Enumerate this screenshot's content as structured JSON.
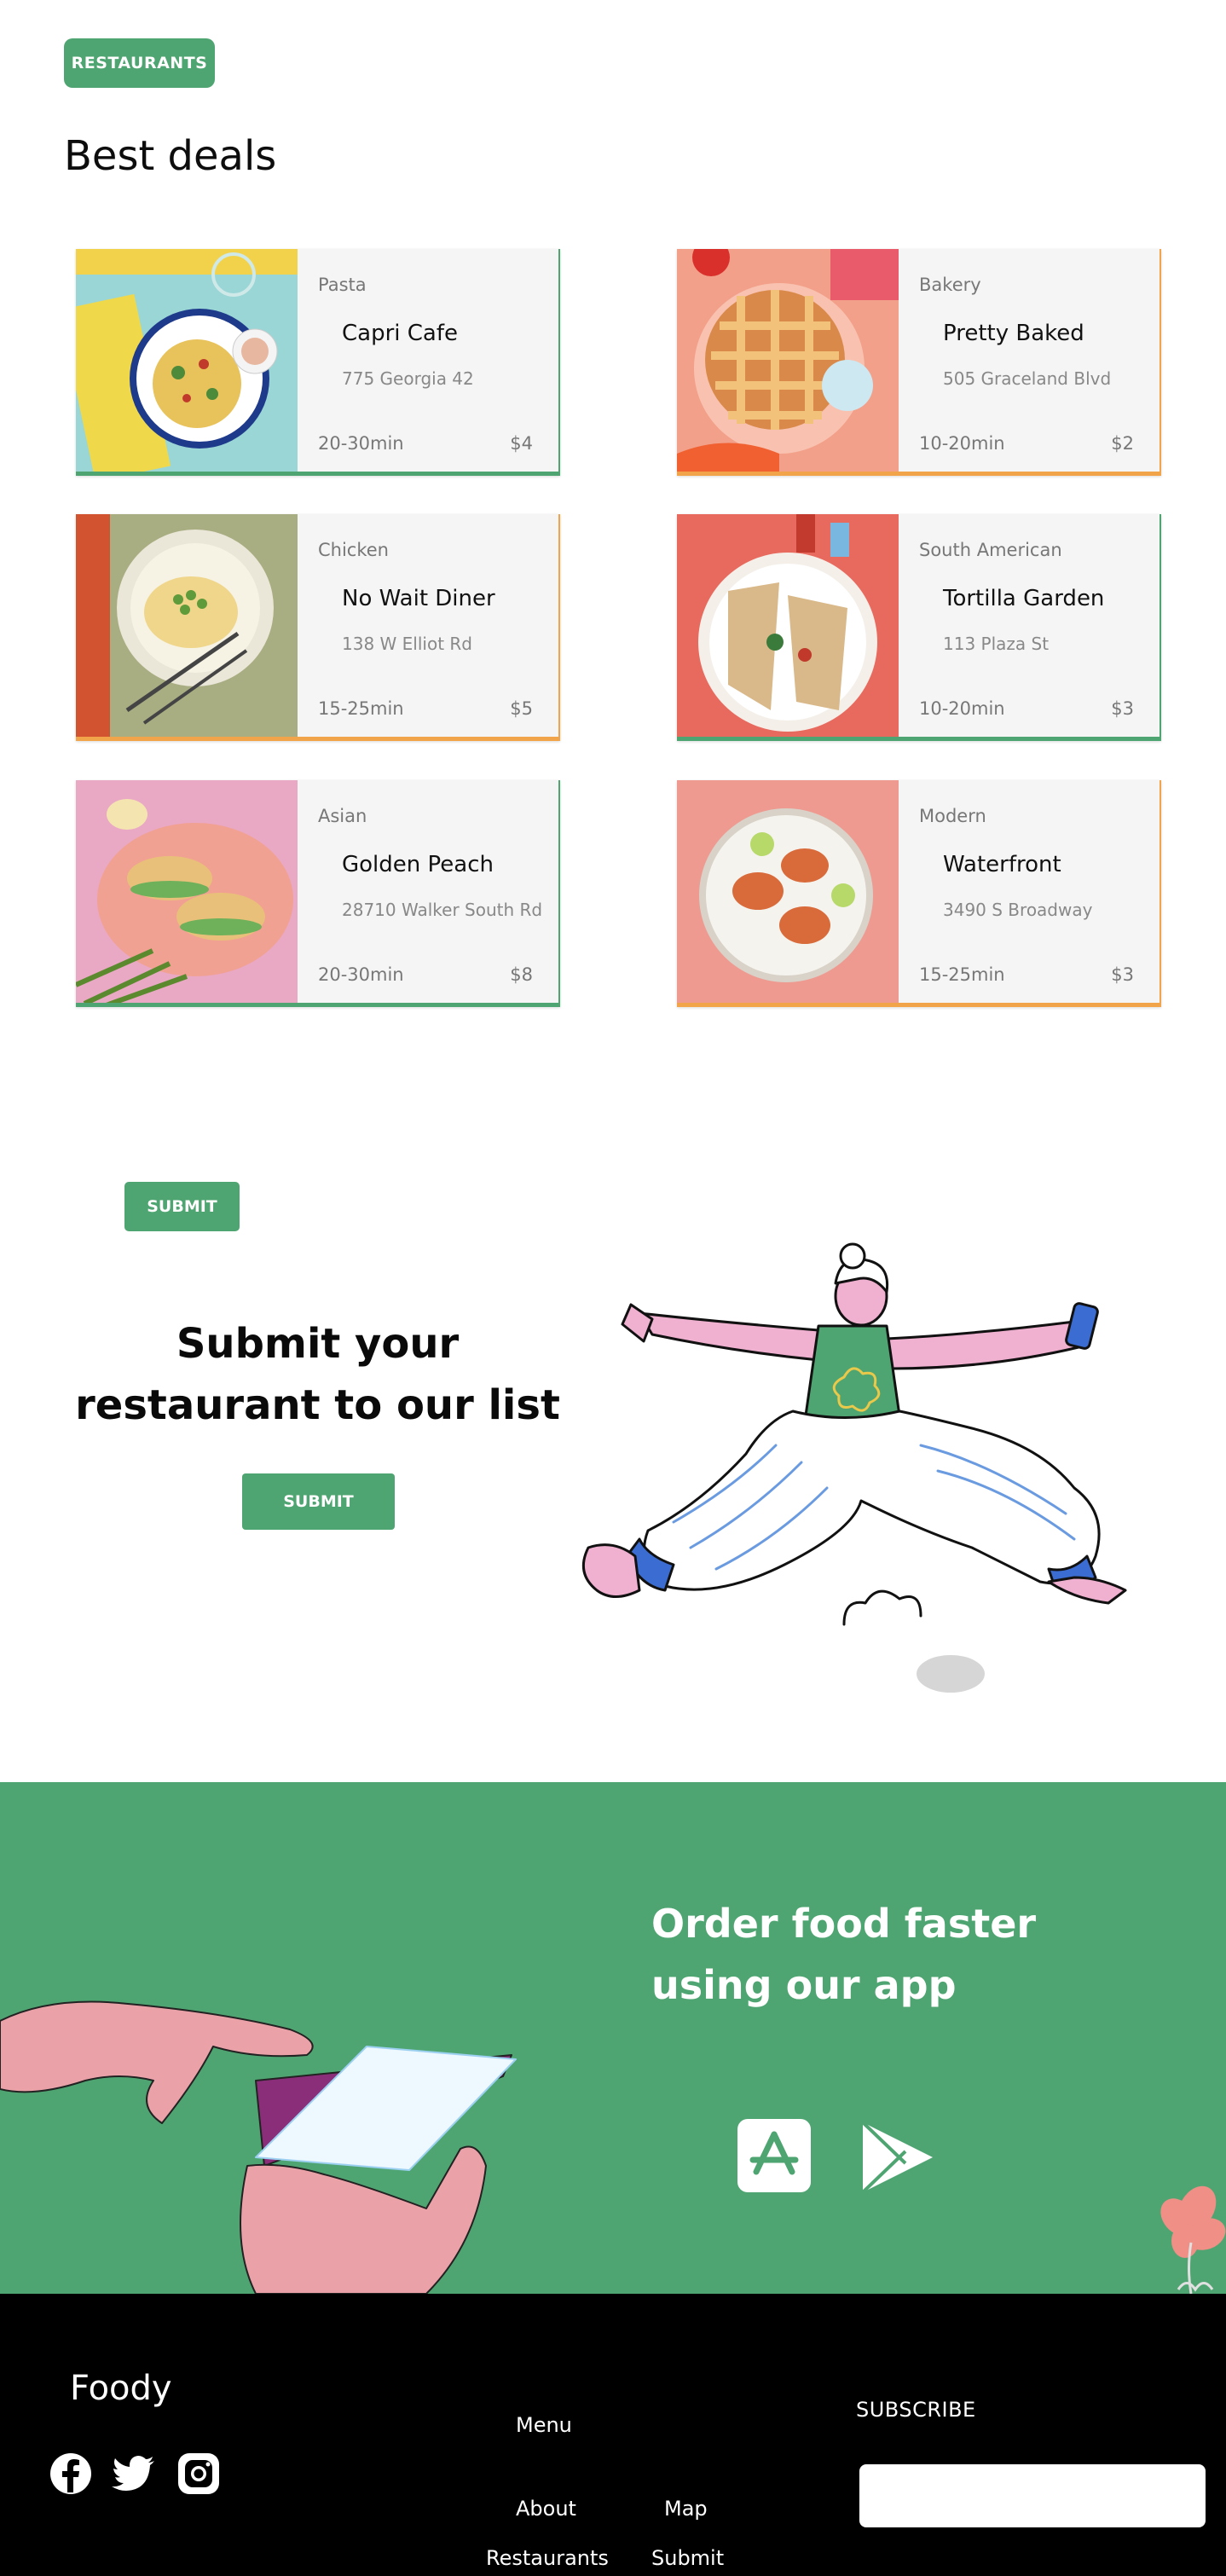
{
  "header": {
    "tag_label": "RESTAURANTS",
    "title": "Best deals"
  },
  "cards": [
    {
      "category": "Pasta",
      "name": "Capri Cafe",
      "address": "775 Georgia 42",
      "time": "20-30min",
      "price": "$4",
      "accent": "#4fa572"
    },
    {
      "category": "Bakery",
      "name": "Pretty Baked",
      "address": "505 Graceland Blvd",
      "time": "10-20min",
      "price": "$2",
      "accent": "#f2a44b"
    },
    {
      "category": "Chicken",
      "name": "No Wait Diner",
      "address": "138 W Elliot Rd",
      "time": "15-25min",
      "price": "$5",
      "accent": "#f2a44b"
    },
    {
      "category": "South American",
      "name": "Tortilla Garden",
      "address": "113 Plaza St",
      "time": "10-20min",
      "price": "$3",
      "accent": "#4fa572"
    },
    {
      "category": "Asian",
      "name": "Golden Peach",
      "address": "28710 Walker South Rd",
      "time": "20-30min",
      "price": "$8",
      "accent": "#4fa572"
    },
    {
      "category": "Modern",
      "name": "Waterfront",
      "address": "3490 S Broadway",
      "time": "15-25min",
      "price": "$3",
      "accent": "#f2a44b"
    }
  ],
  "submit_section": {
    "small_button": "SUBMIT",
    "heading": "Submit your restaurant to our list",
    "button": "SUBMIT"
  },
  "app_section": {
    "heading": "Order food faster using our app",
    "icons": [
      "app-store-icon",
      "google-play-icon"
    ]
  },
  "footer": {
    "logo": "Foody",
    "social_icons": [
      "facebook-icon",
      "twitter-icon",
      "instagram-icon"
    ],
    "menu_title": "Menu",
    "links": [
      "About",
      "Map",
      "Restaurants",
      "Submit"
    ],
    "subscribe_label": "SUBSCRIBE",
    "subscribe_placeholder": ""
  },
  "colors": {
    "brand_green": "#4fa572",
    "accent_orange": "#f2a44b",
    "footer_bg": "#000000"
  }
}
